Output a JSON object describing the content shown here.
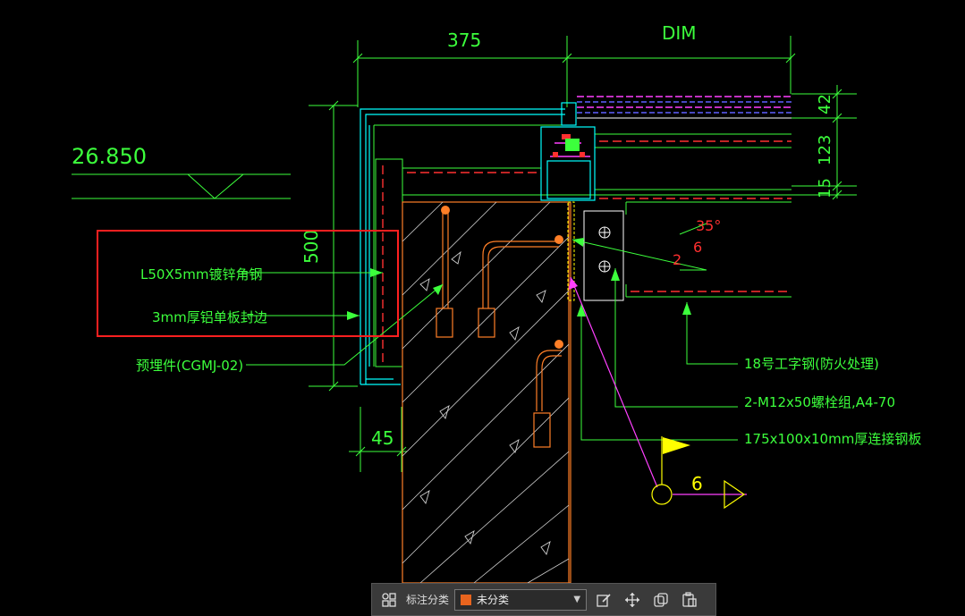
{
  "drawing": {
    "dim_top_left": "375",
    "dim_top_right": "DIM",
    "dim_left_vertical": "500",
    "dim_bottom_left": "45",
    "dim_right_1": "42",
    "dim_right_2": "123",
    "dim_right_3": "15",
    "elevation": "26.850",
    "angle_label": "35°",
    "weld_num_top": "6",
    "weld_num_left": "2",
    "section_mark": "6",
    "labels": {
      "angle_steel": "L50X5mm镀锌角钢",
      "alu_panel": "3mm厚铝单板封边",
      "embed": "预埋件(CGMJ-02)",
      "i_beam": "18号工字钢(防火处理)",
      "bolt": "2-M12x50螺栓组,A4-70",
      "plate": "175x100x10mm厚连接钢板"
    }
  },
  "toolbar": {
    "category_label": "标注分类",
    "category_value": "未分类",
    "swatch_color": "#e8641e",
    "icons": [
      "grid-icon",
      "edit-icon",
      "move-icon",
      "copy-icon",
      "paste-icon"
    ]
  },
  "colors": {
    "green": "#3cff3c",
    "cyan": "#00ffff",
    "orange": "#ff7f27",
    "red": "#ff3030",
    "magenta": "#ff40ff",
    "yellow": "#ffff00",
    "highlight_red": "#ff2020"
  }
}
